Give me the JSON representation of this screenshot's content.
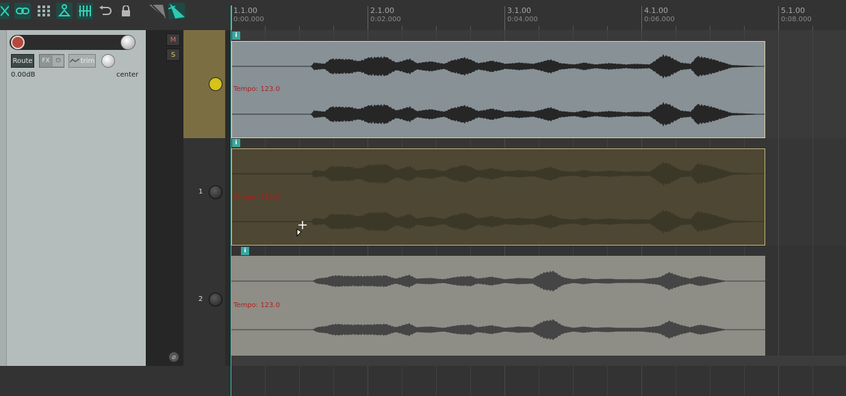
{
  "toolbar": {
    "buttons": [
      "crossfade-icon",
      "link-icon",
      "grid-icon",
      "group-icon",
      "snap-icon",
      "loop-icon",
      "lock-icon",
      "envelope-select-icon",
      "item-edit-icon"
    ]
  },
  "ruler": {
    "marks": [
      {
        "label": "1.1.00",
        "time": "0:00.000"
      },
      {
        "label": "2.1.00",
        "time": "0:02.000"
      },
      {
        "label": "3.1.00",
        "time": "0:04.000"
      },
      {
        "label": "4.1.00",
        "time": "0:06.000"
      },
      {
        "label": "5.1.00",
        "time": "0:08.000"
      }
    ]
  },
  "mixer": {
    "route_label": "Route",
    "fx_label": "FX",
    "trim_label": "trim",
    "volume": "0.00dB",
    "pan": "center",
    "mute_label": "M",
    "solo_label": "S"
  },
  "tracks": [
    {
      "number": "",
      "item_label": "Tempo: 123.0",
      "info": "i"
    },
    {
      "number": "1",
      "item_label": "Tempo: 123.0",
      "info": "i"
    },
    {
      "number": "2",
      "item_label": "Tempo: 123.0",
      "info": "i"
    }
  ],
  "colors": {
    "accent": "#2ec9b2",
    "track0_header": "#7b6e42",
    "item0": "#889196",
    "item1": "#4d4733",
    "item2": "#8f8e86",
    "tempo_text": "#b02020"
  }
}
